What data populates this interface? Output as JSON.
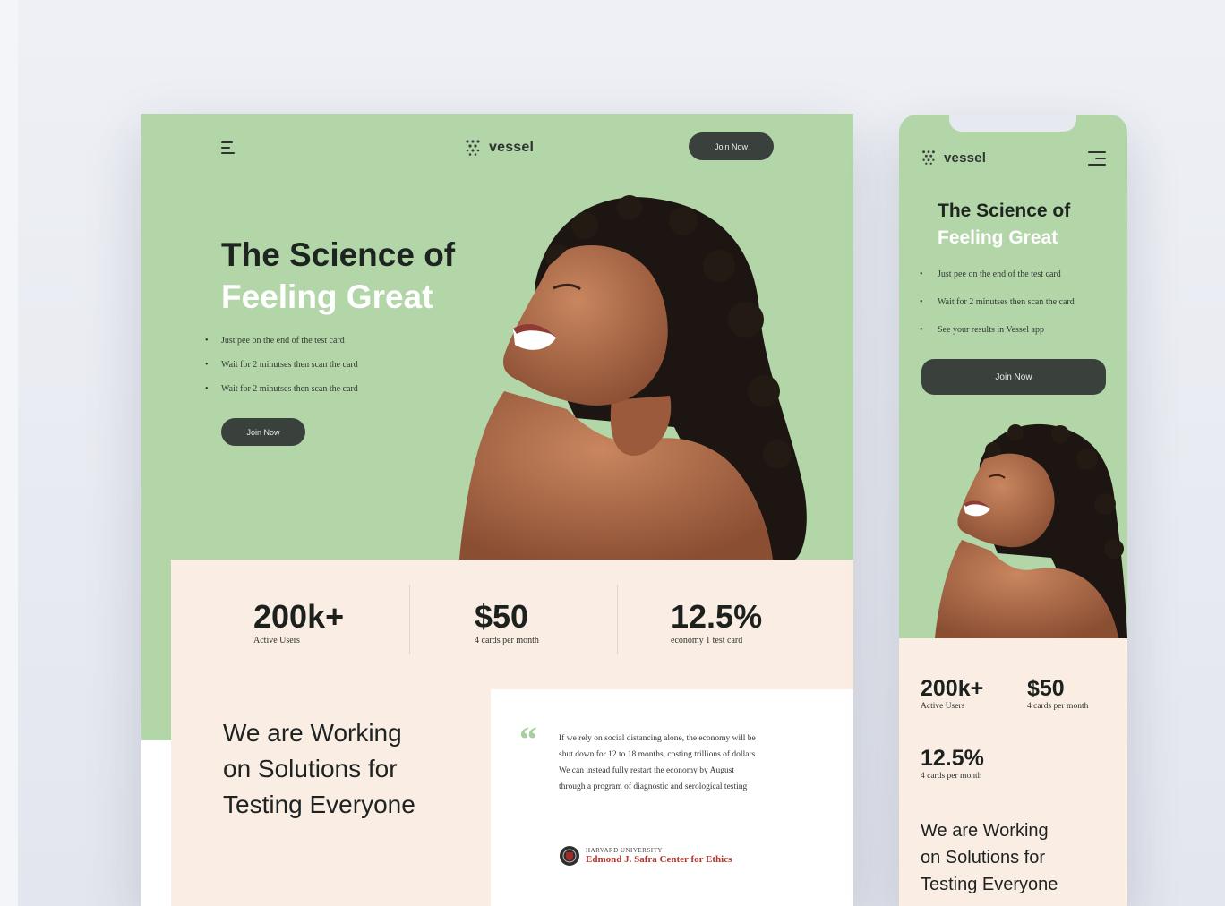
{
  "brand": {
    "name": "vessel",
    "logo_icon": "grape-cluster-icon"
  },
  "colors": {
    "hero_green": "#b3d6a9",
    "accent_dark": "#3a403b",
    "cream": "#faede4",
    "quote_green": "#a7cf9f",
    "harvard_red": "#b2332c"
  },
  "desktop": {
    "join_top_label": "Join Now",
    "hero": {
      "title_line1": "The Science of",
      "title_line2": "Feeling Great",
      "bullets": [
        "Just pee on the end of the test card",
        "Wait for 2 minutses then scan the card",
        "Wait for 2 minutses then scan the card"
      ],
      "cta_label": "Join Now"
    },
    "stats": [
      {
        "value": "200k+",
        "label": "Active Users"
      },
      {
        "value": "$50",
        "label": "4 cards per month"
      },
      {
        "value": "12.5%",
        "label": "economy 1 test card"
      }
    ],
    "working_heading": [
      "We are Working",
      "on Solutions for",
      "Testing Everyone"
    ],
    "quote": {
      "mark": "“",
      "text": "If we rely on social distancing alone, the economy will be shut down for 12 to 18 months, costing trillions of dollars. We can instead fully restart the economy by August through a program of diagnostic and serological testing",
      "org_small": "HARVARD UNIVERSITY",
      "org_name": "Edmond J. Safra Center for Ethics"
    }
  },
  "mobile": {
    "hero": {
      "title_line1": "The Science of",
      "title_line2": "Feeling Great",
      "bullets": [
        "Just pee on the end of the test card",
        "Wait for 2 minutses then scan the card",
        "See your results in Vessel app"
      ],
      "cta_label": "Join Now"
    },
    "stats": [
      {
        "value": "200k+",
        "label": "Active Users"
      },
      {
        "value": "$50",
        "label": "4 cards per month"
      },
      {
        "value": "12.5%",
        "label": "4 cards per month"
      }
    ],
    "working_heading": [
      "We are Working",
      "on Solutions for",
      "Testing Everyone"
    ]
  }
}
